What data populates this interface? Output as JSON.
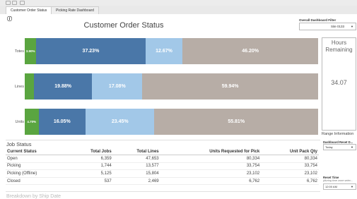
{
  "tabs": [
    {
      "label": "Customer Order Status",
      "active": true
    },
    {
      "label": "Picking Rate Dashboard",
      "active": false
    }
  ],
  "info_icon": "info-icon",
  "title": "Customer Order Status",
  "filter": {
    "label": "Overall Dashboard Filter",
    "value": "Site 0133"
  },
  "hours": {
    "label_line1": "Hours",
    "label_line2": "Remaining",
    "value": "34.07"
  },
  "range_info": "Range Information",
  "reset_date": {
    "label": "Dashboard Reset D...",
    "value": "Today"
  },
  "reset_time": {
    "label": "Reset Time",
    "sublabel": "(during time zone selec...",
    "value": "12:00 AM"
  },
  "colors": {
    "green": "#5aa540",
    "dark_blue": "#4a77a8",
    "light_blue": "#a2c8e8",
    "taupe": "#b7ada6"
  },
  "chart_data": {
    "type": "bar",
    "orientation": "horizontal",
    "stacked": true,
    "normalized": true,
    "categories": [
      "Totes",
      "Lines",
      "Units"
    ],
    "series": [
      {
        "values": [
          3.9,
          3.1,
          4.7
        ],
        "labels": [
          "3.90%",
          "",
          "4.70%"
        ],
        "color": "#5aa540"
      },
      {
        "values": [
          37.23,
          19.88,
          16.05
        ],
        "labels": [
          "37.23%",
          "19.88%",
          "16.05%"
        ],
        "color": "#4a77a8"
      },
      {
        "values": [
          12.67,
          17.08,
          23.45
        ],
        "labels": [
          "12.67%",
          "17.08%",
          "23.45%"
        ],
        "color": "#a2c8e8"
      },
      {
        "values": [
          46.2,
          59.94,
          55.81
        ],
        "labels": [
          "46.20%",
          "59.94%",
          "55.81%"
        ],
        "color": "#b7ada6"
      }
    ]
  },
  "job_status": {
    "title": "Job Status",
    "columns": [
      "Current Status",
      "Total Jobs",
      "Total Lines",
      "Units Requested for Pick",
      "Unit Pack Qty"
    ],
    "rows": [
      [
        "Open",
        "6,359",
        "47,653",
        "80,334",
        "80,334"
      ],
      [
        "Picking",
        "1,744",
        "13,577",
        "33,754",
        "33,754"
      ],
      [
        "Picking (Offline)",
        "5,125",
        "15,804",
        "23,102",
        "23,102"
      ],
      [
        "Closed",
        "537",
        "2,469",
        "6,762",
        "6,762"
      ]
    ]
  },
  "next_section_title": "Breakdown by Ship Date"
}
